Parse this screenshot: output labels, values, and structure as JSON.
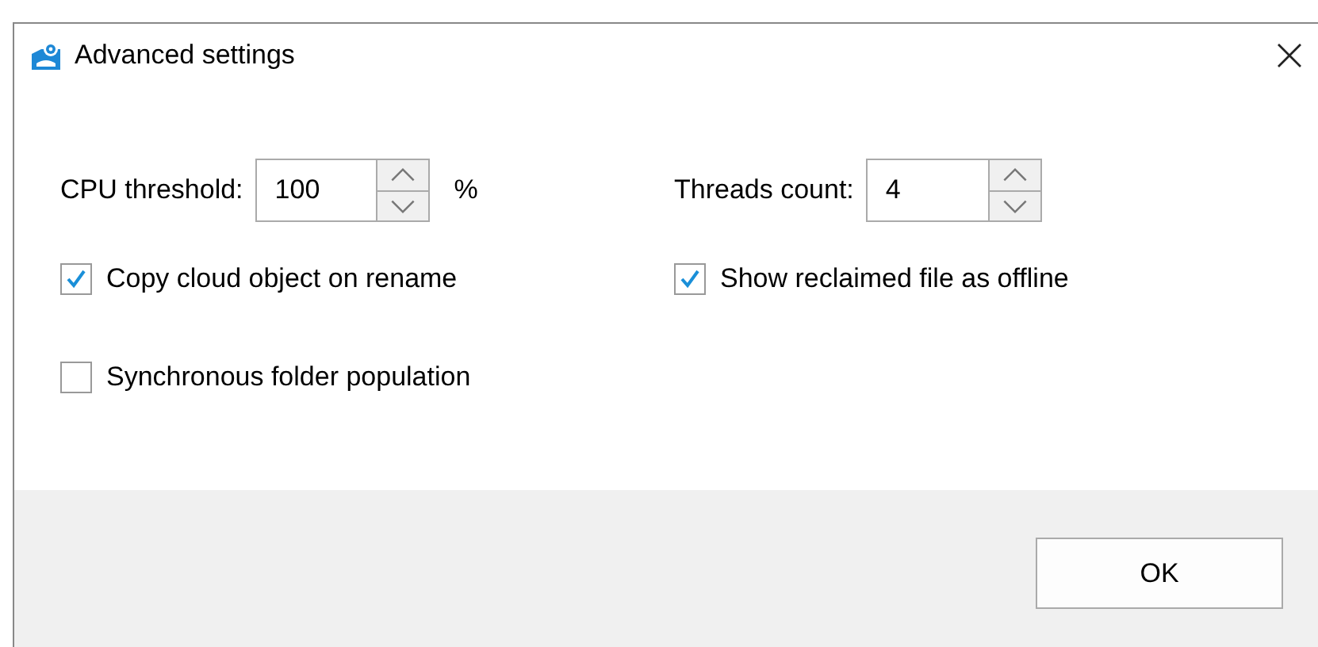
{
  "window": {
    "title": "Advanced settings"
  },
  "spinners": [
    {
      "label": "CPU threshold:",
      "value": "100",
      "unit": "%"
    },
    {
      "label": "Threads count:",
      "value": "4"
    }
  ],
  "checkboxes": [
    {
      "label": "Copy cloud object on rename",
      "checked": true
    },
    {
      "label": "Show reclaimed file as offline",
      "checked": true
    },
    {
      "label": "Synchronous folder population",
      "checked": false
    }
  ],
  "buttons": [
    "OK"
  ]
}
